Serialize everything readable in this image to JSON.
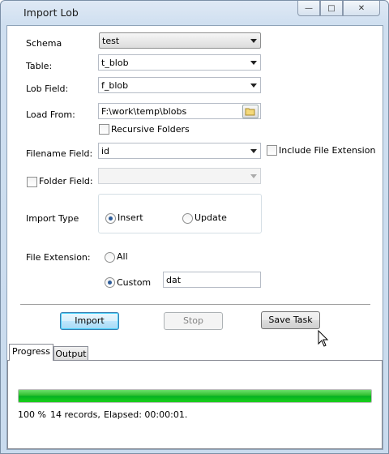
{
  "window": {
    "title": "Import Lob",
    "minimize_glyph": "—",
    "maximize_glyph": "□",
    "close_glyph": "✕"
  },
  "form": {
    "schema": {
      "label": "Schema",
      "value": "test"
    },
    "table": {
      "label": "Table:",
      "value": "t_blob"
    },
    "lob_field": {
      "label": "Lob Field:",
      "value": "f_blob"
    },
    "load_from": {
      "label": "Load From:",
      "value": "F:\\work\\temp\\blobs",
      "browse_icon": "folder-icon"
    },
    "recursive_folders": {
      "label": "Recursive Folders",
      "checked": false
    },
    "filename_field": {
      "label": "Filename Field:",
      "value": "id"
    },
    "include_file_extension": {
      "label": "Include File Extension",
      "checked": false
    },
    "folder_field": {
      "label": "Folder Field:",
      "checked": false,
      "value": ""
    },
    "import_type": {
      "label": "Import Type",
      "options": [
        "Insert",
        "Update"
      ],
      "selected": "Insert"
    },
    "file_extension": {
      "label": "File Extension:",
      "all_label": "All",
      "custom_label": "Custom",
      "selected": "Custom",
      "custom_value": "dat"
    }
  },
  "buttons": {
    "import": "Import",
    "stop": "Stop",
    "save_task": "Save Task"
  },
  "tabs": [
    {
      "label": "Progress",
      "active": true
    },
    {
      "label": "Output",
      "active": false
    }
  ],
  "progress": {
    "fraction": 1.0,
    "percent_text": "100 %",
    "records_text": "14 records,",
    "elapsed_text": "Elapsed: 00:00:01."
  },
  "colors": {
    "progress_fill": "#06b025",
    "default_button_border": "#3c7fb1"
  }
}
